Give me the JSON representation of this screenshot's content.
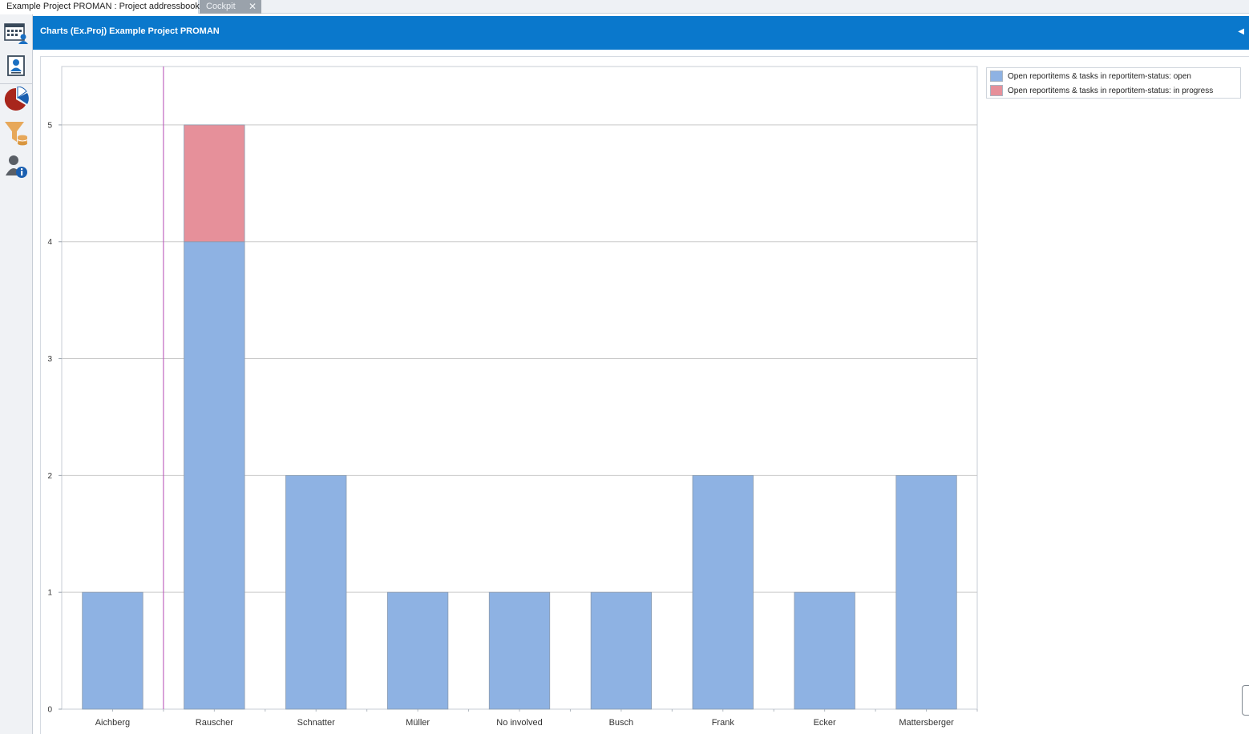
{
  "tabs": [
    {
      "label": "Example Project PROMAN : Project addressbook",
      "active": true
    },
    {
      "label": "Cockpit",
      "active": false,
      "close_symbol": "✕"
    }
  ],
  "rail": {
    "icons": [
      "calendar-grid-icon",
      "contact-card-icon",
      "pie-chart-icon",
      "filter-database-icon",
      "user-info-icon"
    ]
  },
  "header": {
    "title": "Charts (Ex.Proj) Example Project PROMAN",
    "collapse_symbol": "◀"
  },
  "colors": {
    "header_bg": "#0a78cc",
    "series_open": "#8eb2e3",
    "series_in_progress": "#e6909a",
    "marker_line": "#b64bb6"
  },
  "chart_data": {
    "type": "bar",
    "stacked": true,
    "categories": [
      "Aichberg",
      "Rauscher",
      "Schnatter",
      "Müller",
      "No involved",
      "Busch",
      "Frank",
      "Ecker",
      "Mattersberger"
    ],
    "series": [
      {
        "name": "Open reportitems & tasks in reportitem-status: open",
        "color": "#8eb2e3",
        "values": [
          1,
          4,
          2,
          1,
          1,
          1,
          2,
          1,
          2
        ]
      },
      {
        "name": "Open reportitems & tasks in reportitem-status: in progress",
        "color": "#e6909a",
        "values": [
          0,
          1,
          0,
          0,
          0,
          0,
          0,
          0,
          0
        ]
      }
    ],
    "yticks": [
      0,
      1,
      2,
      3,
      4,
      5
    ],
    "ylim": [
      0,
      5.5
    ],
    "grid": true,
    "legend_position": "top-right",
    "marker_after_category": "Aichberg"
  }
}
